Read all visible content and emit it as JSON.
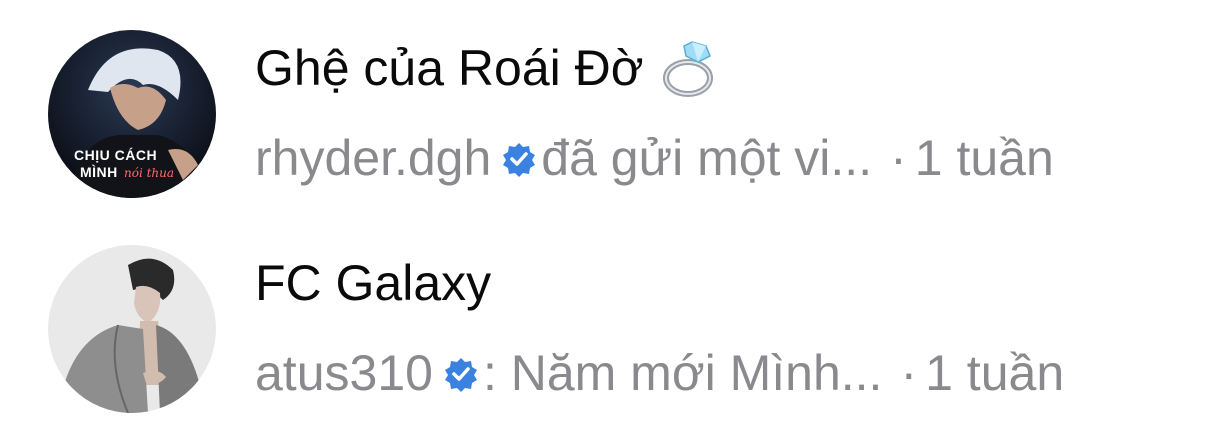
{
  "conversations": [
    {
      "title": "Ghệ của Roái Đờ",
      "title_emoji": "ring-icon",
      "avatar_icon": "album-cover-avatar",
      "avatar_text_line1": "CHỊU CÁCH",
      "avatar_text_line2": "MÌNH",
      "avatar_text_script": "nói thua",
      "sender": "rhyder.dgh",
      "verified": true,
      "preview": "đã gửi một vi...",
      "separator": "·",
      "time": "1 tuần"
    },
    {
      "title": "FC Galaxy",
      "avatar_icon": "person-photo-avatar",
      "sender": "atus310",
      "verified": true,
      "preview": ": Năm mới Mình...",
      "separator": "·",
      "time": "1 tuần"
    }
  ],
  "colors": {
    "title": "#0a0a0a",
    "secondary": "#8a8a8e",
    "verified_badge": "#3b82e0",
    "background": "#ffffff"
  }
}
